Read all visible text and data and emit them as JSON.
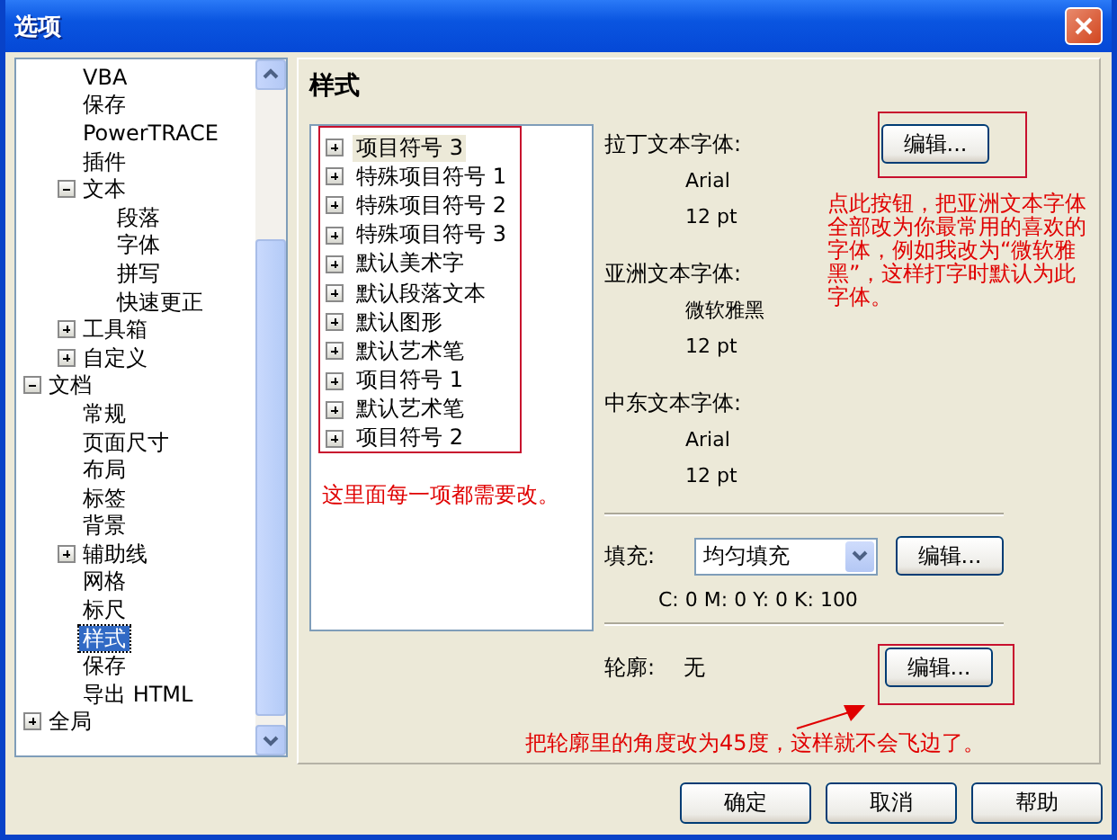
{
  "window": {
    "title": "选项"
  },
  "tree": {
    "items": [
      {
        "children": [
          {
            "label": "VBA",
            "selected": false
          },
          {
            "label": "保存",
            "selected": false
          },
          {
            "label": "PowerTRACE",
            "selected": false
          },
          {
            "label": "插件",
            "selected": false
          },
          {
            "label": "文本",
            "selected": false,
            "expanded": true,
            "children": [
              {
                "label": "段落",
                "selected": false
              },
              {
                "label": "字体",
                "selected": false
              },
              {
                "label": "拼写",
                "selected": false
              },
              {
                "label": "快速更正",
                "selected": false
              }
            ]
          },
          {
            "label": "工具箱",
            "selected": false,
            "expanded": false
          },
          {
            "label": "自定义",
            "selected": false,
            "expanded": false
          }
        ]
      },
      {
        "label": "文档",
        "selected": false,
        "expanded": true,
        "children": [
          {
            "label": "常规",
            "selected": false
          },
          {
            "label": "页面尺寸",
            "selected": false
          },
          {
            "label": "布局",
            "selected": false
          },
          {
            "label": "标签",
            "selected": false
          },
          {
            "label": "背景",
            "selected": false
          },
          {
            "label": "辅助线",
            "selected": false,
            "expanded": false
          },
          {
            "label": "网格",
            "selected": false
          },
          {
            "label": "标尺",
            "selected": false
          },
          {
            "label": "样式",
            "selected": true
          },
          {
            "label": "保存",
            "selected": false
          },
          {
            "label": "导出 HTML",
            "selected": false
          }
        ]
      },
      {
        "label": "全局",
        "selected": false,
        "expanded": false
      }
    ]
  },
  "page": {
    "heading": "样式",
    "styles": [
      {
        "label": "项目符号 3",
        "selected": true,
        "expanded": false
      },
      {
        "label": "特殊项目符号 1",
        "selected": false,
        "expanded": false
      },
      {
        "label": "特殊项目符号 2",
        "selected": false,
        "expanded": false
      },
      {
        "label": "特殊项目符号 3",
        "selected": false,
        "expanded": false
      },
      {
        "label": "默认美术字",
        "selected": false,
        "expanded": false
      },
      {
        "label": "默认段落文本",
        "selected": false,
        "expanded": false
      },
      {
        "label": "默认图形",
        "selected": false,
        "expanded": false
      },
      {
        "label": "默认艺术笔",
        "selected": false,
        "expanded": false
      },
      {
        "label": "项目符号 1",
        "selected": false,
        "expanded": false
      },
      {
        "label": "默认艺术笔",
        "selected": false,
        "expanded": false
      },
      {
        "label": "项目符号 2",
        "selected": false,
        "expanded": false
      }
    ],
    "fonts": [
      {
        "label": "拉丁文本字体:",
        "font": "Arial",
        "size": "12 pt"
      },
      {
        "label": "亚洲文本字体:",
        "font": "微软雅黑",
        "size": "12 pt"
      },
      {
        "label": "中东文本字体:",
        "font": "Arial",
        "size": "12 pt"
      }
    ],
    "font_edit_button": "编辑...",
    "fill": {
      "label": "填充:",
      "value": "均匀填充",
      "edit_button": "编辑...",
      "color_values": "C: 0 M: 0 Y: 0 K: 100"
    },
    "outline": {
      "label": "轮廓:",
      "value": "无",
      "edit_button": "编辑..."
    }
  },
  "annotations": {
    "list_note": "这里面每一项都需要改。",
    "edit_note": "点此按钮，把亚洲文本字体全部改为你最常用的喜欢的字体，例如我改为“微软雅黑”，这样打字时默认为此字体。",
    "outline_note": "把轮廓里的角度改为45度，这样就不会飞边了。"
  },
  "buttons": [
    {
      "label": "确定"
    },
    {
      "label": "取消"
    },
    {
      "label": "帮助"
    }
  ]
}
